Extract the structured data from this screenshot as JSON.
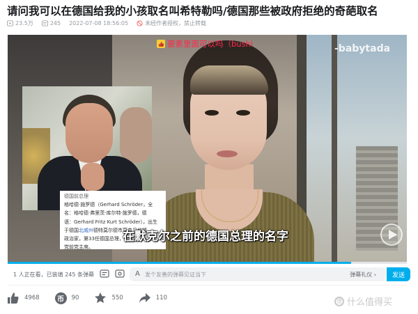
{
  "title": "请问我可以在德国给我的小孩取名叫希特勒吗/德国那些被政府拒绝的奇葩取名",
  "meta": {
    "views": "23.5万",
    "comments": "245",
    "date": "2022-07-08 18:56:05",
    "notice": "未经作者授权，禁止转载"
  },
  "player": {
    "uploader_watermark": "-babytada",
    "danmaku": "要素里面可以吗（bushi",
    "subtitle": "在默克尔之前的德国总理的名字",
    "info_card": {
      "heading": "德国前总理",
      "lines": [
        "格哈德·施罗德（Gerhard Schröder，全",
        "名：格哈德·弗里茨·库尔特·施罗德，德",
        "语：Gerhard Fritz Kurt Schröder），出生",
        "于德国北威州德特莫尔德市莫森贝格镇，",
        "政治家，第33任德国总理，德国社会民主",
        "党前党主席。"
      ],
      "link_text": "北威州"
    },
    "progress": 0.86
  },
  "controls": {
    "viewers_text": "1 人正在看，已装填 245 条弹幕",
    "input_icon": "A",
    "placeholder": "发个友善的弹幕见证当下",
    "etiquette": "弹幕礼仪 ›",
    "send_label": "发送"
  },
  "actions": {
    "likes": "4968",
    "coins": "90",
    "favorites": "550",
    "shares": "110"
  },
  "watermark": "什么值得买",
  "colors": {
    "accent": "#00aeec",
    "danmaku": "#ff2a4a",
    "muted": "#9499a0"
  }
}
